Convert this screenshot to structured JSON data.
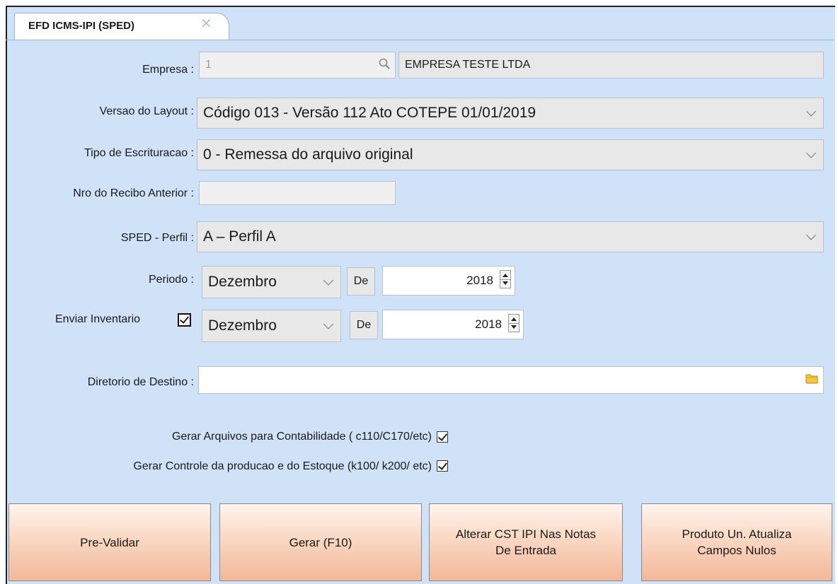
{
  "tab": {
    "title": "EFD ICMS-IPI (SPED)",
    "close": "✕"
  },
  "form": {
    "empresa": {
      "label": "Empresa :",
      "code": "1",
      "name": "EMPRESA TESTE LTDA"
    },
    "versao_layout": {
      "label": "Versao do Layout :",
      "value": "Código 013 - Versão 112 Ato COTEPE 01/01/2019"
    },
    "tipo_escrituracao": {
      "label": "Tipo de Escrituracao :",
      "value": "0 - Remessa do arquivo original"
    },
    "nro_recibo": {
      "label": "Nro do Recibo Anterior :",
      "value": ""
    },
    "sped_perfil": {
      "label": "SPED - Perfil :",
      "value": "A – Perfil A"
    },
    "periodo": {
      "label": "Periodo :",
      "month": "Dezembro",
      "de_label": "De",
      "year": "2018"
    },
    "enviar_inventario": {
      "label": "Enviar Inventario",
      "checked": true,
      "month": "Dezembro",
      "de_label": "De",
      "year": "2018"
    },
    "diretorio_destino": {
      "label": "Diretorio de Destino :",
      "value": ""
    },
    "gerar_contabilidade": {
      "label": "Gerar Arquivos para Contabilidade ( c110/C170/etc)",
      "checked": true
    },
    "gerar_controle": {
      "label": "Gerar Controle da producao e do Estoque (k100/ k200/ etc)",
      "checked": true
    }
  },
  "buttons": {
    "pre_validar": "Pre-Validar",
    "gerar": "Gerar (F10)",
    "alterar_cst": "Alterar CST IPI Nas Notas\nDe Entrada",
    "produto_un": "Produto Un. Atualiza\nCampos Nulos"
  }
}
